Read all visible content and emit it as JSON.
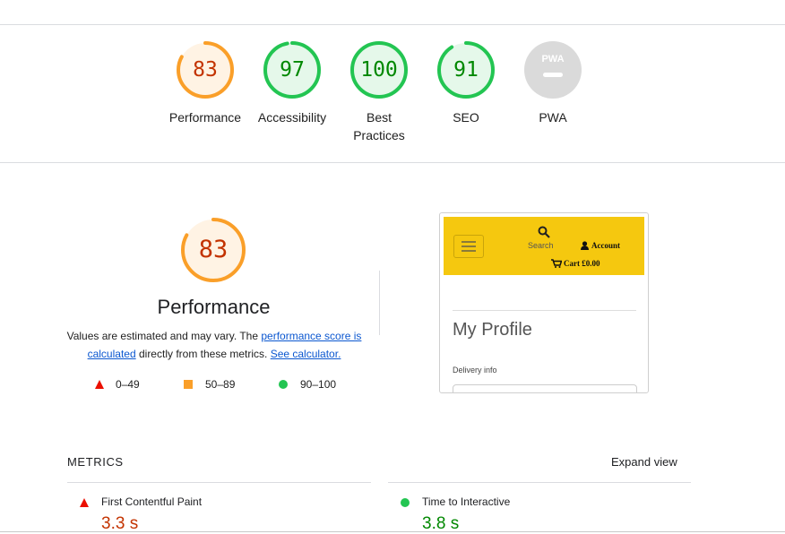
{
  "scores": [
    {
      "label": "Performance",
      "value": "83",
      "fraction": 0.83,
      "color": "#fa9f29",
      "bg": "#fff3e4",
      "text": "#c33300"
    },
    {
      "label": "Accessibility",
      "value": "97",
      "fraction": 0.97,
      "color": "#23c552",
      "bg": "#e5f8ea",
      "text": "#008800"
    },
    {
      "label": "Best Practices",
      "label_line1": "Best",
      "label_line2": "Practices",
      "value": "100",
      "fraction": 1.0,
      "color": "#23c552",
      "bg": "#e5f8ea",
      "text": "#008800"
    },
    {
      "label": "SEO",
      "value": "91",
      "fraction": 0.91,
      "color": "#23c552",
      "bg": "#e5f8ea",
      "text": "#008800"
    },
    {
      "label": "PWA",
      "badge": "PWA",
      "color": "#dadada"
    }
  ],
  "performance": {
    "score": "83",
    "fraction": 0.83,
    "title": "Performance",
    "desc_prefix": "Values are estimated and may vary. The ",
    "link1": "performance score is calculated",
    "desc_mid": " directly from these metrics. ",
    "link2": "See calculator."
  },
  "legend": [
    {
      "icon": "triangle-fail",
      "range": "0–49",
      "color": "#eb0f00"
    },
    {
      "icon": "square-average",
      "range": "50–89",
      "color": "#fa9f29"
    },
    {
      "icon": "circle-pass",
      "range": "90–100",
      "color": "#23c552"
    }
  ],
  "screenshot": {
    "search_label": "Search",
    "account_label": "Account",
    "cart_label": "Cart £0.00",
    "heading": "My Profile",
    "sub": "Delivery info",
    "header_color": "#f5c80f"
  },
  "metrics": {
    "heading": "METRICS",
    "expand": "Expand view",
    "items": [
      {
        "name": "First Contentful Paint",
        "value": "3.3 s",
        "status": "fail",
        "color": "#c33300"
      },
      {
        "name": "Time to Interactive",
        "value": "3.8 s",
        "status": "pass",
        "color": "#008800"
      }
    ]
  }
}
